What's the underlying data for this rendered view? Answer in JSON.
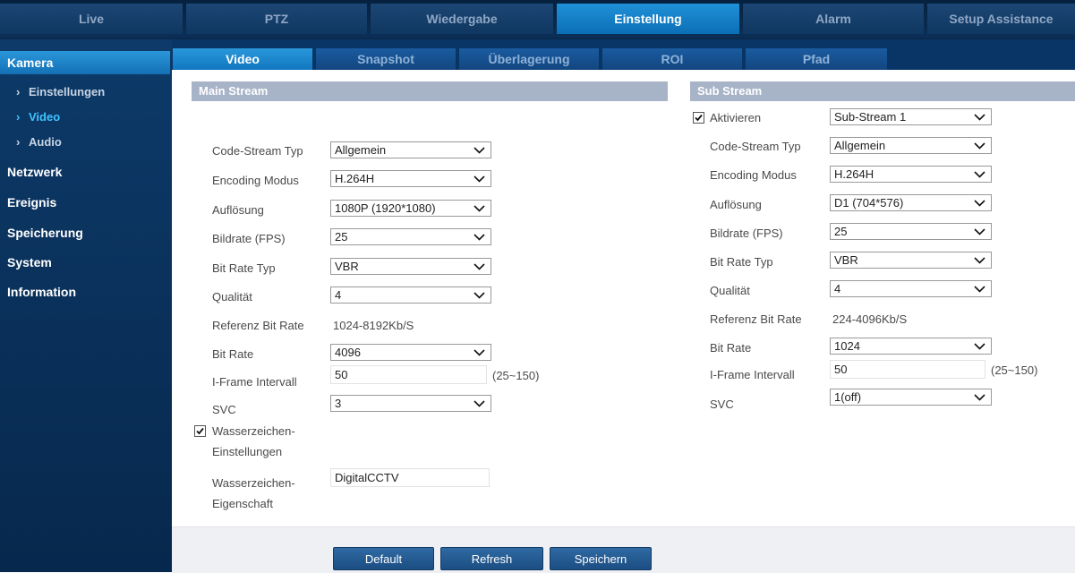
{
  "top_nav": [
    "Live",
    "PTZ",
    "Wiedergabe",
    "Einstellung",
    "Alarm",
    "Setup Assistance"
  ],
  "sidebar": {
    "categories": {
      "kamera": "Kamera",
      "netzwerk": "Netzwerk",
      "ereignis": "Ereignis",
      "speicherung": "Speicherung",
      "system": "System",
      "information": "Information"
    },
    "sub_items": [
      "Einstellungen",
      "Video",
      "Audio"
    ],
    "active_sub": "Video"
  },
  "sub_tabs": [
    "Video",
    "Snapshot",
    "Überlagerung",
    "ROI",
    "Pfad"
  ],
  "main_stream": {
    "header": "Main Stream",
    "code_stream_typ": {
      "label": "Code-Stream Typ",
      "value": "Allgemein"
    },
    "encoding_modus": {
      "label": "Encoding Modus",
      "value": "H.264H"
    },
    "aufloesung": {
      "label": "Auflösung",
      "value": "1080P (1920*1080)"
    },
    "bildrate": {
      "label": "Bildrate (FPS)",
      "value": "25"
    },
    "bit_rate_typ": {
      "label": "Bit Rate Typ",
      "value": "VBR"
    },
    "qualitaet": {
      "label": "Qualität",
      "value": "4"
    },
    "referenz_bit_rate": {
      "label": "Referenz Bit Rate",
      "value": "1024-8192Kb/S"
    },
    "bit_rate": {
      "label": "Bit Rate",
      "value": "4096"
    },
    "iframe": {
      "label": "I-Frame Intervall",
      "value": "50",
      "range": "(25~150)"
    },
    "svc": {
      "label": "SVC",
      "value": "3"
    },
    "wasserzeichen_einstellungen": {
      "label_line1": "Wasserzeichen-",
      "label_line2": "Einstellungen",
      "checked": true
    },
    "wasserzeichen_eigenschaft": {
      "label_line1": "Wasserzeichen-",
      "label_line2": "Eigenschaft",
      "value": "DigitalCCTV"
    }
  },
  "sub_stream": {
    "header": "Sub Stream",
    "aktivieren": {
      "label": "Aktivieren",
      "checked": true,
      "value": "Sub-Stream 1"
    },
    "code_stream_typ": {
      "label": "Code-Stream Typ",
      "value": "Allgemein"
    },
    "encoding_modus": {
      "label": "Encoding Modus",
      "value": "H.264H"
    },
    "aufloesung": {
      "label": "Auflösung",
      "value": "D1 (704*576)"
    },
    "bildrate": {
      "label": "Bildrate (FPS)",
      "value": "25"
    },
    "bit_rate_typ": {
      "label": "Bit Rate Typ",
      "value": "VBR"
    },
    "qualitaet": {
      "label": "Qualität",
      "value": "4"
    },
    "referenz_bit_rate": {
      "label": "Referenz Bit Rate",
      "value": "224-4096Kb/S"
    },
    "bit_rate": {
      "label": "Bit Rate",
      "value": "1024"
    },
    "iframe": {
      "label": "I-Frame Intervall",
      "value": "50",
      "range": "(25~150)"
    },
    "svc": {
      "label": "SVC",
      "value": "1(off)"
    }
  },
  "buttons": {
    "default": "Default",
    "refresh": "Refresh",
    "speichern": "Speichern"
  },
  "icons": {
    "dropdown": "chevron-down-icon",
    "check": "checkmark-icon",
    "sub_item": "chevron-right-icon"
  },
  "colors": {
    "active_tab": "#1f90d8",
    "nav_bg": "#06213f",
    "section_header": "#a7b3c7",
    "active_sub_text": "#3ec4ff"
  }
}
